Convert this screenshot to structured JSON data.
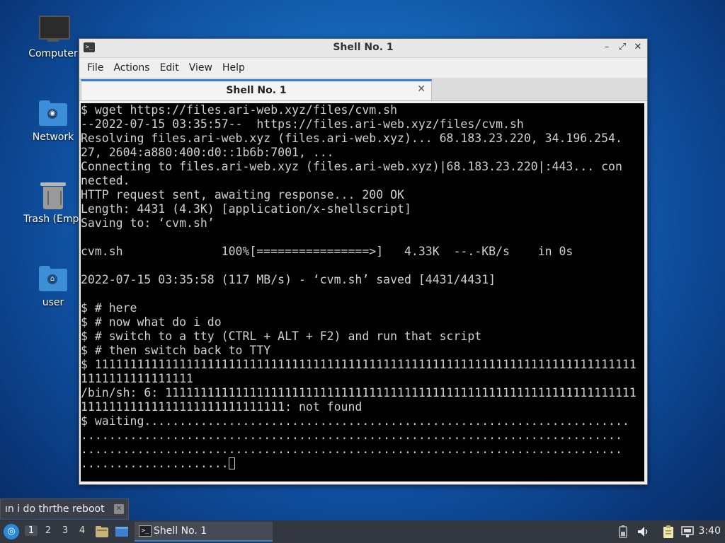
{
  "desktop": {
    "icons": [
      {
        "label": "Computer"
      },
      {
        "label": "Network"
      },
      {
        "label": "Trash (Empt"
      },
      {
        "label": "user"
      }
    ]
  },
  "window": {
    "title": "Shell No. 1",
    "controls": {
      "minimize": "–",
      "maximize": "⤢",
      "close": "✕"
    },
    "menu": [
      "File",
      "Actions",
      "Edit",
      "View",
      "Help"
    ],
    "tab": {
      "label": "Shell No. 1",
      "close": "✕"
    }
  },
  "terminal": {
    "lines": [
      "$ wget https://files.ari-web.xyz/files/cvm.sh",
      "--2022-07-15 03:35:57--  https://files.ari-web.xyz/files/cvm.sh",
      "Resolving files.ari-web.xyz (files.ari-web.xyz)... 68.183.23.220, 34.196.254.",
      "27, 2604:a880:400:d0::1b6b:7001, ...",
      "Connecting to files.ari-web.xyz (files.ari-web.xyz)|68.183.23.220|:443... con",
      "nected.",
      "HTTP request sent, awaiting response... 200 OK",
      "Length: 4431 (4.3K) [application/x-shellscript]",
      "Saving to: ‘cvm.sh’",
      "",
      "cvm.sh              100%[================>]   4.33K  --.-KB/s    in 0s",
      "",
      "2022-07-15 03:35:58 (117 MB/s) - ‘cvm.sh’ saved [4431/4431]",
      "",
      "$ # here",
      "$ # now what do i do",
      "$ # switch to a tty (CTRL + ALT + F2) and run that script",
      "$ # then switch back to TTY",
      "$ 11111111111111111111111111111111111111111111111111111111111111111111111111111",
      "1111111111111111",
      "/bin/sh: 6: 1111111111111111111111111111111111111111111111111111111111111111111",
      "11111111111111111111111111111: not found",
      "$ waiting.....................................................................",
      ".............................................................................",
      ".............................................................................",
      "....................."
    ]
  },
  "input_bar": {
    "text": "ın i do thrthe reboot",
    "clear": "✕"
  },
  "panel": {
    "start": "◎",
    "workspaces": [
      "1",
      "2",
      "3",
      "4"
    ],
    "active_workspace": "1",
    "task_label": "Shell No. 1",
    "tray_icons": [
      "battery-icon",
      "volume-icon",
      "clipboard-icon",
      "network-icon"
    ],
    "clock": "3:40"
  }
}
